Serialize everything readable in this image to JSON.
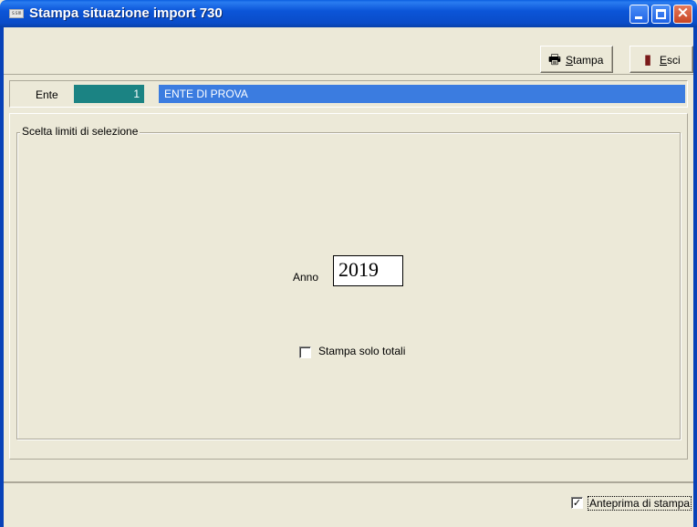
{
  "window": {
    "title": "Stampa situazione import 730",
    "app_icon_text": "ssm",
    "controls": {
      "minimize": "minimize",
      "maximize": "maximize",
      "close": "×"
    },
    "title_bar_color": "#0a55d8"
  },
  "toolbar": {
    "stampa_label": "Stampa",
    "stampa_icon": "printer-icon",
    "esci_label": "Esci",
    "esci_icon": "exit-door-icon"
  },
  "ente": {
    "label": "Ente",
    "code": "1",
    "name": "ENTE DI PROVA",
    "code_bg": "#1b8383",
    "name_bg": "#3b7ce0"
  },
  "selection": {
    "group_title": "Scelta limiti di selezione",
    "anno_label": "Anno",
    "anno_value": "2019",
    "solo_totali_label": "Stampa solo totali",
    "solo_totali_checked": false
  },
  "footer": {
    "anteprima_label": "Anteprima di stampa",
    "anteprima_checked": true
  }
}
